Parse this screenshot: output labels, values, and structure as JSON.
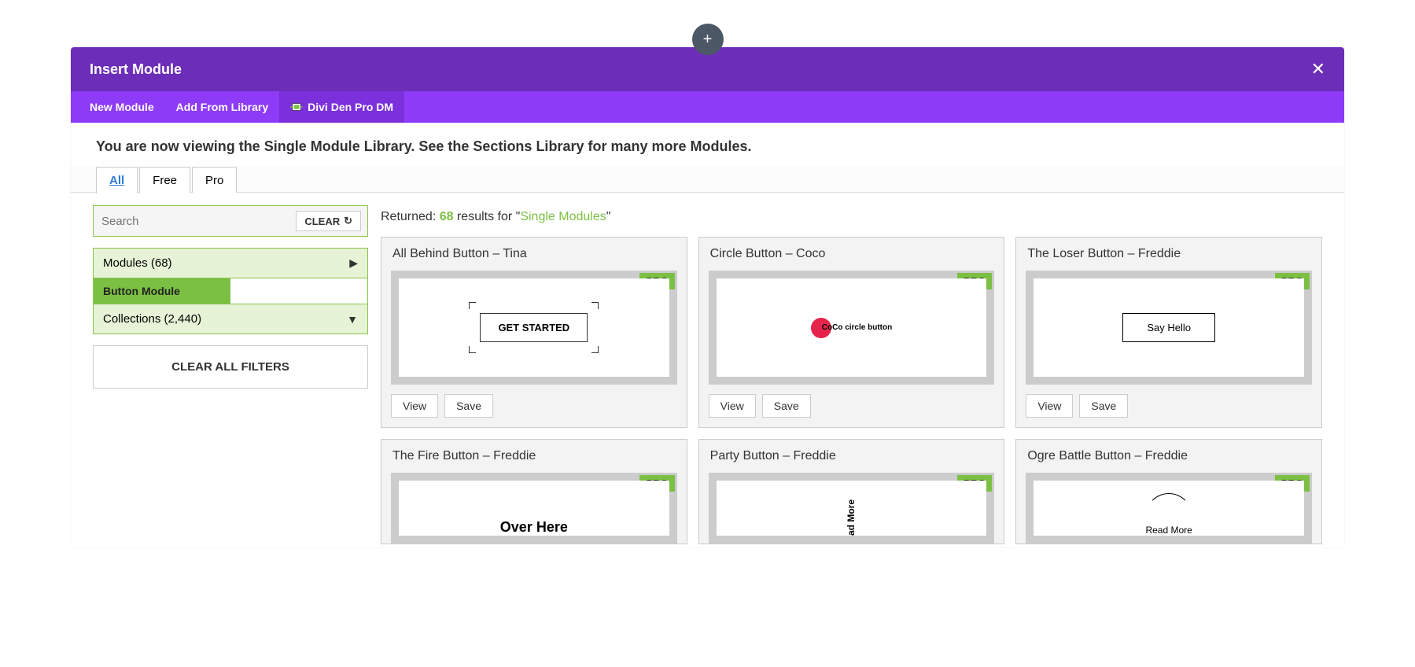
{
  "add_button_label": "+",
  "modal": {
    "title": "Insert Module",
    "tabs": {
      "new_module": "New Module",
      "add_from_library": "Add From Library",
      "divi_den": "Divi Den Pro DM"
    }
  },
  "info_text": "You are now viewing the Single Module Library. See the Sections Library for many more Modules.",
  "filter_tabs": {
    "all": "All",
    "free": "Free",
    "pro": "Pro"
  },
  "search": {
    "placeholder": "Search",
    "clear_label": "CLEAR"
  },
  "accordions": {
    "modules": {
      "label": "Modules",
      "count": "(68)"
    },
    "button_module": "Button Module",
    "collections": {
      "label": "Collections",
      "count": "(2,440)"
    }
  },
  "clear_all_filters": "CLEAR ALL FILTERS",
  "results": {
    "prefix": "Returned: ",
    "count": "68",
    "mid": " results for \"",
    "term": "Single Modules",
    "suffix": "\""
  },
  "badge": {
    "pro": "PRO"
  },
  "card_actions": {
    "view": "View",
    "save": "Save"
  },
  "cards": [
    {
      "title": "All Behind Button – Tina",
      "preview": "GET STARTED"
    },
    {
      "title": "Circle Button – Coco",
      "preview": "CoCo circle button"
    },
    {
      "title": "The Loser Button – Freddie",
      "preview": "Say Hello"
    },
    {
      "title": "The Fire Button – Freddie",
      "preview": "Over Here"
    },
    {
      "title": "Party Button – Freddie",
      "preview": "ad More"
    },
    {
      "title": "Ogre Battle Button – Freddie",
      "preview": "Read More"
    }
  ]
}
